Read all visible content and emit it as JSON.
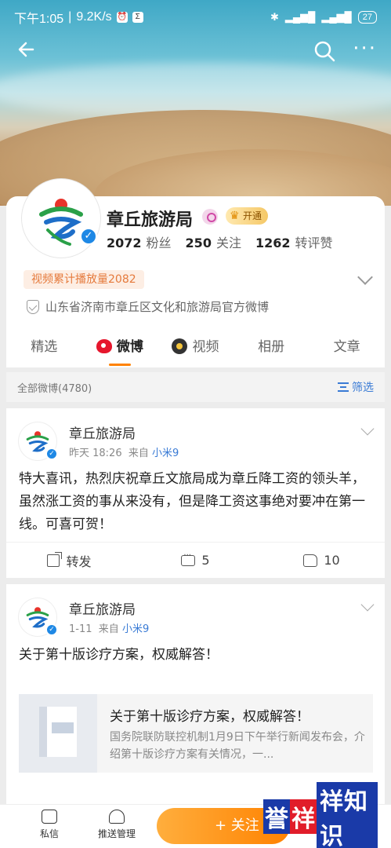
{
  "status_bar": {
    "time": "下午1:05",
    "speed": "9.2K/s",
    "battery": "27"
  },
  "profile": {
    "name": "章丘旅游局",
    "vip_label": "开通",
    "followers_count": "2072",
    "followers_label": "粉丝",
    "following_count": "250",
    "following_label": "关注",
    "engagement_count": "1262",
    "engagement_label": "转评赞",
    "play_count": "视频累计播放量2082",
    "official_desc": "山东省济南市章丘区文化和旅游局官方微博"
  },
  "tabs": [
    {
      "label": "精选"
    },
    {
      "label": "微博"
    },
    {
      "label": "视频"
    },
    {
      "label": "相册"
    },
    {
      "label": "文章"
    }
  ],
  "filter": {
    "total_label": "全部微博(4780)",
    "filter_label": "筛选"
  },
  "posts": [
    {
      "author": "章丘旅游局",
      "time": "昨天 18:26",
      "from_prefix": "来自",
      "source": "小米9",
      "text": "特大喜讯，热烈庆祝章丘文旅局成为章丘降工资的领头羊，虽然涨工资的事从来没有，但是降工资这事绝对要冲在第一线。可喜可贺！",
      "repost_label": "转发",
      "comment_count": "5",
      "like_count": "10"
    },
    {
      "author": "章丘旅游局",
      "time": "1-11",
      "from_prefix": "来自",
      "source": "小米9",
      "text": "关于第十版诊疗方案，权威解答！",
      "link_title": "关于第十版诊疗方案，权威解答！",
      "link_desc": "国务院联防联控机制1月9日下午举行新闻发布会，介绍第十版诊疗方案有关情况，一..."
    }
  ],
  "bottom_bar": {
    "message_label": "私信",
    "push_label": "推送管理",
    "follow_label": "+ 关注"
  },
  "watermark": {
    "part1": "誉",
    "part2": "祥",
    "part3": "祥知识"
  },
  "colors": {
    "accent": "#ff8200",
    "link": "#3a7bd5",
    "verify": "#1e88e5"
  }
}
